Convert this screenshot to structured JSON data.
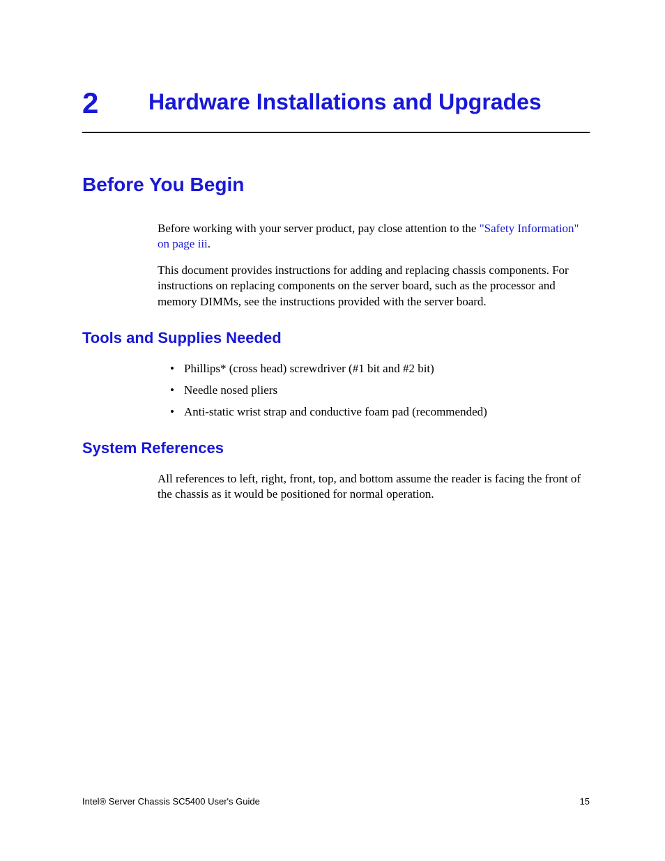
{
  "chapter": {
    "number": "2",
    "title": "Hardware Installations and Upgrades"
  },
  "section1": {
    "title": "Before You Begin",
    "para1_pre": "Before working with your server product, pay close attention to the ",
    "para1_link": "\"Safety Information\" on page iii",
    "para1_post": ".",
    "para2": "This document provides instructions for adding and replacing chassis components. For instructions on replacing components on the server board, such as the processor and memory DIMMs, see the instructions provided with the server board."
  },
  "section2": {
    "title": "Tools and Supplies Needed",
    "items": [
      "Phillips* (cross head) screwdriver (#1 bit and #2 bit)",
      "Needle nosed pliers",
      "Anti-static wrist strap and conductive foam pad (recommended)"
    ]
  },
  "section3": {
    "title": "System References",
    "para1": "All references to left, right, front, top, and bottom assume the reader is facing the front of the chassis as it would be positioned for normal operation."
  },
  "footer": {
    "doc_title": "Intel® Server Chassis SC5400 User's Guide",
    "page_number": "15"
  }
}
